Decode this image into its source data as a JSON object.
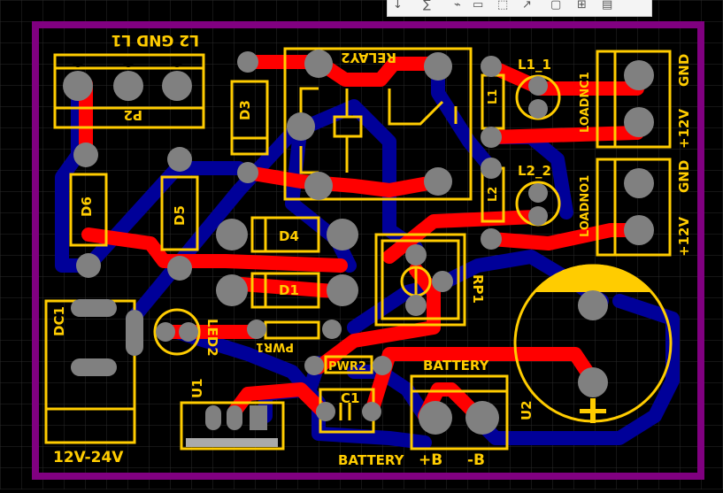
{
  "toolbar": {
    "icons": [
      "arrow-down-icon",
      "sigma-icon",
      "route-icon",
      "box-icon",
      "select-icon",
      "copy-icon",
      "group-icon",
      "table-icon"
    ],
    "glyphs": [
      "↓",
      "∑",
      "⌁",
      "▭",
      "⬚",
      "↗",
      "▢",
      "⊞",
      "▤"
    ]
  },
  "colors": {
    "background": "#000000",
    "board_outline": "#800080",
    "top_copper": "#ff0000",
    "bottom_copper": "#000099",
    "silkscreen": "#ffcc00",
    "pad": "#808080"
  },
  "labels": {
    "p2_pins": "L2  GND   L1",
    "p2": "P2",
    "d3": "D3",
    "relay2": "RELAY2",
    "l1": "L1",
    "l1_1": "L1_1",
    "loadnc1": "LOADNC1",
    "gnd1": "GND",
    "plus12v1": "+12V",
    "d6": "D6",
    "d5": "D5",
    "d4": "D4",
    "l2": "L2",
    "l2_2": "L2_2",
    "loadno1": "LOADNO1",
    "gnd2": "GND",
    "plus12v2": "+12V",
    "d1": "D1",
    "rp1": "RP1",
    "dc1": "DC1",
    "led2": "LED2",
    "pwr1": "PWR1",
    "pwr2": "PWR2",
    "battery_top": "BATTERY",
    "c1": "C1",
    "u1": "U1",
    "u2": "U2",
    "supply": "12V-24V",
    "battery_bottom": "BATTERY",
    "plus_b": "+B",
    "minus_b": "-B"
  }
}
